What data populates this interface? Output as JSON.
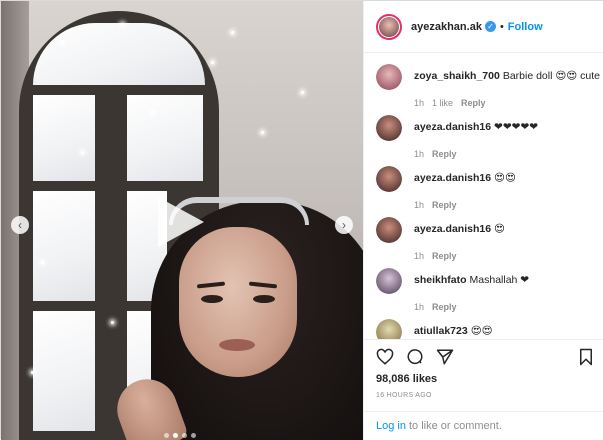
{
  "post": {
    "username": "ayezakhan.ak",
    "separator": "•",
    "follow_label": "Follow"
  },
  "media": {
    "type": "video",
    "play_icon": "play-icon",
    "prev_icon": "chevron-left-icon",
    "next_icon": "chevron-right-icon",
    "carousel_count": 4,
    "carousel_active_index": 1
  },
  "comments": [
    {
      "user": "zoya_shaikh_700",
      "text": "Barbie doll 😍😍 cute",
      "time": "1h",
      "likes": "1 like",
      "reply": "Reply"
    },
    {
      "user": "ayeza.danish16",
      "text": "❤❤❤❤❤",
      "time": "1h",
      "likes": "",
      "reply": "Reply"
    },
    {
      "user": "ayeza.danish16",
      "text": "😍😍",
      "time": "1h",
      "likes": "",
      "reply": "Reply"
    },
    {
      "user": "ayeza.danish16",
      "text": "😍",
      "time": "1h",
      "likes": "",
      "reply": "Reply"
    },
    {
      "user": "sheikhfato",
      "text": "Mashallah ❤",
      "time": "1h",
      "likes": "",
      "reply": "Reply"
    },
    {
      "user": "atiullak723",
      "text": "😍😍",
      "time": "",
      "likes": "",
      "reply": ""
    }
  ],
  "actions": {
    "like_icon": "heart-icon",
    "comment_icon": "comment-icon",
    "share_icon": "share-icon",
    "save_icon": "bookmark-icon"
  },
  "likes_count": "98,086 likes",
  "posted_ago": "16 HOURS AGO",
  "login_prompt": {
    "link": "Log in",
    "text": "to like or comment."
  },
  "colors": {
    "accent": "#0095f6",
    "verified": "#3897f0",
    "muted": "#8e8e8e",
    "text": "#262626"
  }
}
